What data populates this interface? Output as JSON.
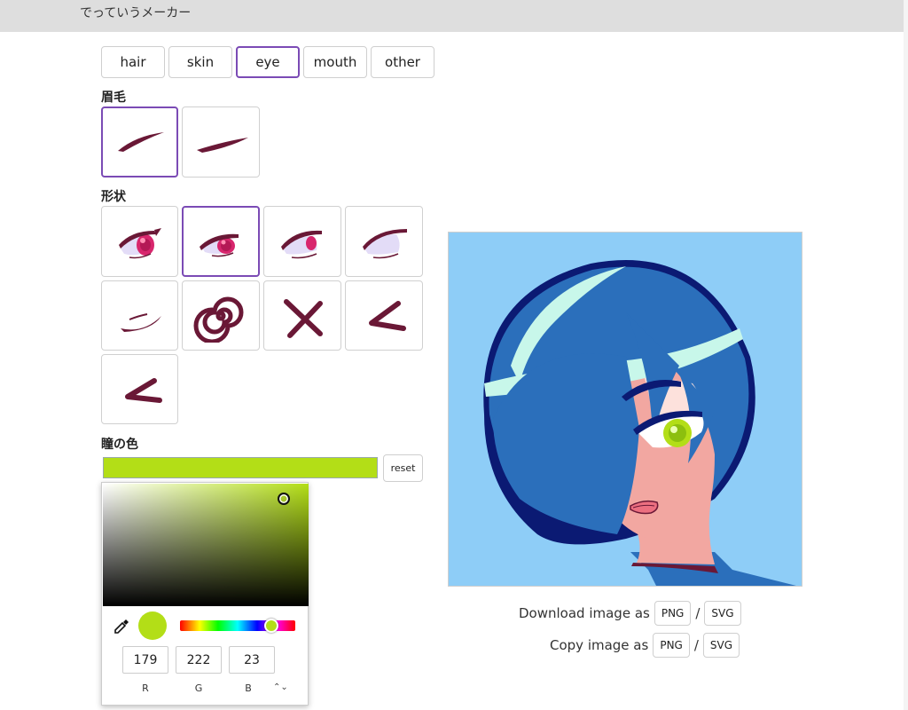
{
  "app": {
    "title": "でっていうメーカー"
  },
  "tabs": [
    {
      "label": "hair",
      "active": false
    },
    {
      "label": "skin",
      "active": false
    },
    {
      "label": "eye",
      "active": true
    },
    {
      "label": "mouth",
      "active": false
    },
    {
      "label": "other",
      "active": false
    }
  ],
  "sections": {
    "eyebrow_label": "眉毛",
    "shape_label": "形状",
    "pupil_color_label": "瞳の色"
  },
  "colors": {
    "accent": "#7b4bb5",
    "pupil": "#b3de17",
    "stroke": "#6a1836",
    "background": "#8ecdf7"
  },
  "pupil_color": {
    "value": "#b3de17",
    "reset_label": "reset"
  },
  "picker": {
    "r": "179",
    "g": "222",
    "b": "23",
    "r_label": "R",
    "g_label": "G",
    "b_label": "B",
    "mode_toggle": "⌃⌄"
  },
  "export": {
    "download_text": "Download image as",
    "copy_text": "Copy image as",
    "png_label": "PNG",
    "svg_label": "SVG",
    "separator": "/"
  }
}
